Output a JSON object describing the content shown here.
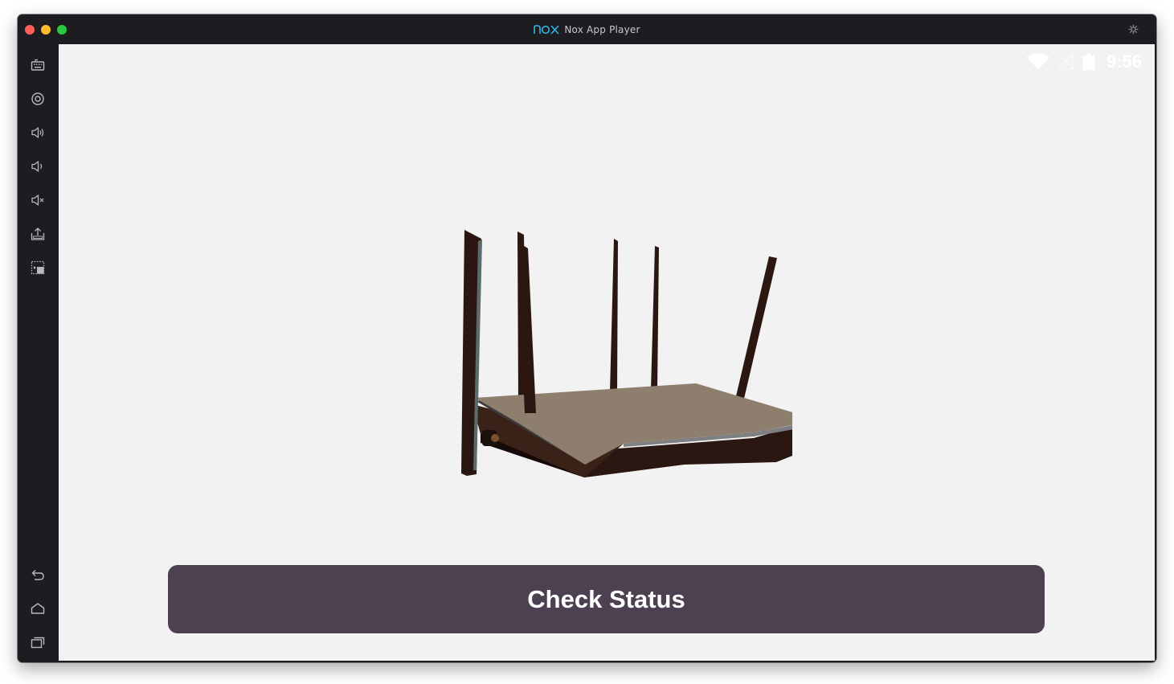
{
  "window": {
    "title": "Nox App Player",
    "logo": "nox-logo"
  },
  "titlebar": {
    "traffic_lights": [
      "close",
      "minimize",
      "maximize"
    ],
    "settings_icon": "gear-icon"
  },
  "sidebar": {
    "top_items": [
      {
        "name": "keyboard-icon"
      },
      {
        "name": "location-icon"
      },
      {
        "name": "volume-up-icon"
      },
      {
        "name": "volume-down-icon"
      },
      {
        "name": "mute-icon"
      },
      {
        "name": "apk-install-icon"
      },
      {
        "name": "multi-instance-icon"
      }
    ],
    "bottom_items": [
      {
        "name": "back-icon"
      },
      {
        "name": "home-icon"
      },
      {
        "name": "recent-apps-icon"
      }
    ]
  },
  "statusbar": {
    "time": "9:56",
    "icons": [
      "wifi-icon",
      "no-signal-icon",
      "battery-icon"
    ]
  },
  "main": {
    "illustration": "wifi-router",
    "button_label": "Check Status"
  },
  "colors": {
    "titlebar": "#1d1d21",
    "screen_bg": "#f2f2f2",
    "button_bg": "#4c4051",
    "button_text": "#ffffff"
  }
}
